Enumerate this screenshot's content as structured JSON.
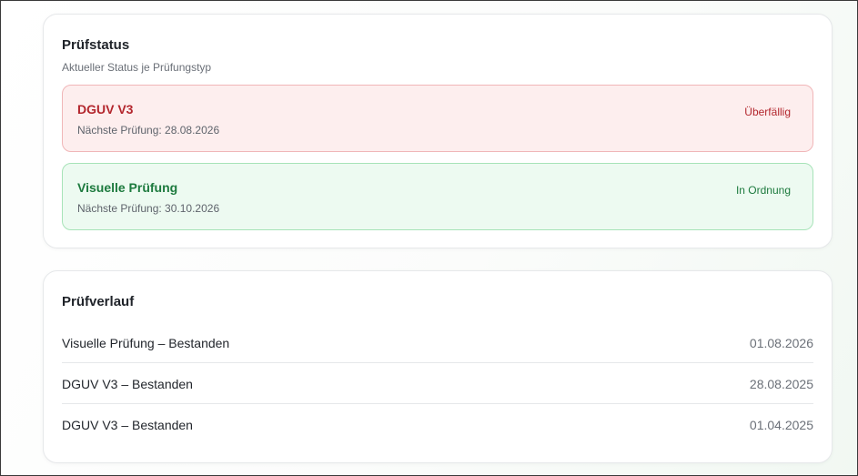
{
  "status_card": {
    "title": "Prüfstatus",
    "subtitle": "Aktueller Status je Prüfungstyp",
    "items": [
      {
        "name": "DGUV V3",
        "next": "Nächste Prüfung: 28.08.2026",
        "status": "Überfällig",
        "color": "#b3262d"
      },
      {
        "name": "Visuelle Prüfung",
        "next": "Nächste Prüfung: 30.10.2026",
        "status": "In Ordnung",
        "color": "#1d7a3e"
      }
    ]
  },
  "history_card": {
    "title": "Prüfverlauf",
    "rows": [
      {
        "label": "Visuelle Prüfung – Bestanden",
        "date": "01.08.2026"
      },
      {
        "label": "DGUV V3 – Bestanden",
        "date": "28.08.2025"
      },
      {
        "label": "DGUV V3 – Bestanden",
        "date": "01.04.2025"
      }
    ]
  }
}
